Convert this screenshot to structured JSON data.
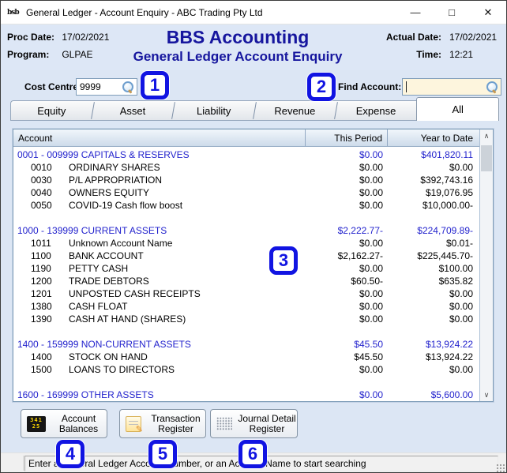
{
  "window": {
    "title": "General Ledger - Account Enquiry - ABC Trading Pty Ltd",
    "icon_text": "bsb",
    "controls": [
      {
        "name": "minimize",
        "glyph": "—"
      },
      {
        "name": "maximize",
        "glyph": "□"
      },
      {
        "name": "close",
        "glyph": "✕"
      }
    ]
  },
  "header": {
    "title": "BBS Accounting",
    "subtitle": "General Ledger Account Enquiry",
    "proc_date_label": "Proc Date:",
    "proc_date": "17/02/2021",
    "program_label": "Program:",
    "program": "GLPAE",
    "actual_date_label": "Actual Date:",
    "actual_date": "17/02/2021",
    "time_label": "Time:",
    "time": "12:21"
  },
  "controls": {
    "cost_centre_label": "Cost Centre:",
    "cost_centre_value": "9999",
    "find_account_label": "Find Account:",
    "find_account_value": ""
  },
  "tabs": [
    {
      "label": "Equity",
      "active": false
    },
    {
      "label": "Asset",
      "active": false
    },
    {
      "label": "Liability",
      "active": false
    },
    {
      "label": "Revenue",
      "active": false
    },
    {
      "label": "Expense",
      "active": false
    },
    {
      "label": "All",
      "active": true
    }
  ],
  "table": {
    "columns": [
      "Account",
      "This Period",
      "Year to Date"
    ],
    "scroll_up_glyph": "∧",
    "scroll_down_glyph": "∨",
    "rows": [
      {
        "type": "section",
        "account": "0001 - 009999 CAPITALS & RESERVES",
        "period": "$0.00",
        "ytd": "$401,820.11"
      },
      {
        "type": "detail",
        "code": "0010",
        "name": "ORDINARY SHARES",
        "period": "$0.00",
        "ytd": "$0.00"
      },
      {
        "type": "detail",
        "code": "0030",
        "name": "P/L APPROPRIATION",
        "period": "$0.00",
        "ytd": "$392,743.16"
      },
      {
        "type": "detail",
        "code": "0040",
        "name": "OWNERS EQUITY",
        "period": "$0.00",
        "ytd": "$19,076.95"
      },
      {
        "type": "detail",
        "code": "0050",
        "name": "COVID-19 Cash flow boost",
        "period": "$0.00",
        "ytd": "$10,000.00-"
      },
      {
        "type": "blank"
      },
      {
        "type": "section",
        "account": "1000 - 139999 CURRENT ASSETS",
        "period": "$2,222.77-",
        "ytd": "$224,709.89-"
      },
      {
        "type": "detail",
        "code": "1011",
        "name": "Unknown Account Name",
        "period": "$0.00",
        "ytd": "$0.01-"
      },
      {
        "type": "detail",
        "code": "1100",
        "name": "BANK ACCOUNT",
        "period": "$2,162.27-",
        "ytd": "$225,445.70-"
      },
      {
        "type": "detail",
        "code": "1190",
        "name": "PETTY CASH",
        "period": "$0.00",
        "ytd": "$100.00"
      },
      {
        "type": "detail",
        "code": "1200",
        "name": "TRADE DEBTORS",
        "period": "$60.50-",
        "ytd": "$635.82"
      },
      {
        "type": "detail",
        "code": "1201",
        "name": "UNPOSTED CASH RECEIPTS",
        "period": "$0.00",
        "ytd": "$0.00"
      },
      {
        "type": "detail",
        "code": "1380",
        "name": "CASH FLOAT",
        "period": "$0.00",
        "ytd": "$0.00"
      },
      {
        "type": "detail",
        "code": "1390",
        "name": "CASH AT HAND (SHARES)",
        "period": "$0.00",
        "ytd": "$0.00"
      },
      {
        "type": "blank"
      },
      {
        "type": "section",
        "account": "1400 - 159999 NON-CURRENT ASSETS",
        "period": "$45.50",
        "ytd": "$13,924.22"
      },
      {
        "type": "detail",
        "code": "1400",
        "name": "STOCK ON HAND",
        "period": "$45.50",
        "ytd": "$13,924.22"
      },
      {
        "type": "detail",
        "code": "1500",
        "name": "LOANS TO DIRECTORS",
        "period": "$0.00",
        "ytd": "$0.00"
      },
      {
        "type": "blank"
      },
      {
        "type": "section",
        "account": "1600 - 169999 OTHER ASSETS",
        "period": "$0.00",
        "ytd": "$5,600.00"
      }
    ]
  },
  "footer": {
    "buttons": [
      {
        "name": "account-balances-button",
        "label": "Account\nBalances",
        "icon": "account-balances-icon",
        "icon_text": [
          "341",
          "25"
        ]
      },
      {
        "name": "transaction-register-button",
        "label": "Transaction\nRegister",
        "icon": "transaction-register-icon",
        "icon_text": []
      },
      {
        "name": "journal-detail-register-button",
        "label": "Journal Detail\nRegister",
        "icon": "journal-detail-register-icon",
        "icon_text": []
      }
    ]
  },
  "annotations": [
    {
      "n": "1"
    },
    {
      "n": "2"
    },
    {
      "n": "3"
    },
    {
      "n": "4"
    },
    {
      "n": "5"
    },
    {
      "n": "6"
    }
  ],
  "status_bar": {
    "message": "Enter a General Ledger Account Number, or an Account Name to start searching"
  },
  "colors": {
    "navy_title": "#16169e",
    "section_blue": "#2323cd",
    "annotation_blue": "#1114e2",
    "find_input_cream": "#fdf5dd",
    "header_band": "#dde7f6",
    "window_bg": "#dce6f4"
  }
}
